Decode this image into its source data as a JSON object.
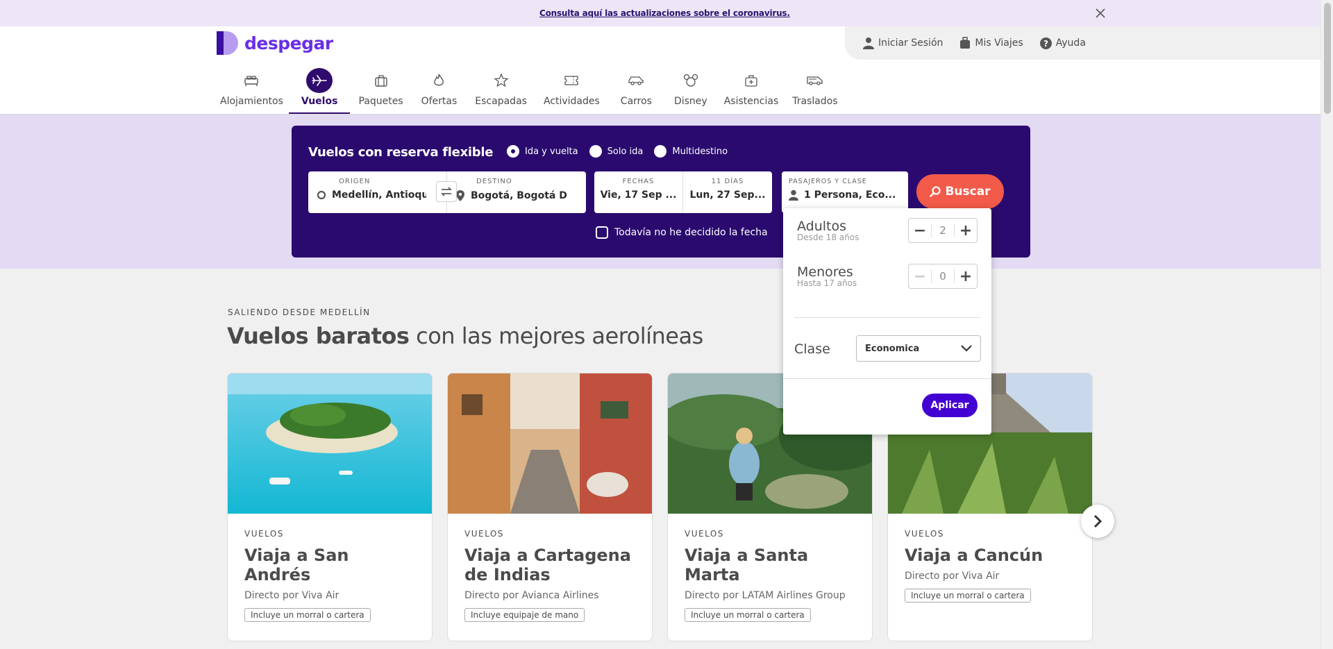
{
  "banner": {
    "link_text": "Consulta aquí las actualizaciones sobre el coronavirus."
  },
  "brand": {
    "name": "despegar"
  },
  "user_bar": [
    {
      "label": "Iniciar Sesión",
      "icon": "user-icon"
    },
    {
      "label": "Mis Viajes",
      "icon": "suitcase-icon"
    },
    {
      "label": "Ayuda",
      "icon": "help-icon"
    }
  ],
  "nav": {
    "items": [
      {
        "label": "Alojamientos",
        "icon": "bed-icon"
      },
      {
        "label": "Vuelos",
        "icon": "plane-icon",
        "active": true
      },
      {
        "label": "Paquetes",
        "icon": "package-icon"
      },
      {
        "label": "Ofertas",
        "icon": "flame-icon"
      },
      {
        "label": "Escapadas",
        "icon": "star-icon"
      },
      {
        "label": "Actividades",
        "icon": "ticket-icon"
      },
      {
        "label": "Carros",
        "icon": "car-icon"
      },
      {
        "label": "Disney",
        "icon": "mickey-icon"
      },
      {
        "label": "Asistencias",
        "icon": "medkit-icon"
      },
      {
        "label": "Traslados",
        "icon": "van-icon"
      }
    ]
  },
  "search": {
    "title": "Vuelos con reserva flexible",
    "trip_types": [
      {
        "label": "Ida y vuelta",
        "checked": true
      },
      {
        "label": "Solo ida",
        "checked": false
      },
      {
        "label": "Multidestino",
        "checked": false
      }
    ],
    "origin": {
      "label": "ORIGEN",
      "value": "Medellín, Antioqui..."
    },
    "destination": {
      "label": "DESTINO",
      "value": "Bogotá, Bogotá D...."
    },
    "dates": {
      "label": "FECHAS",
      "value": "Vie, 17 Sep ..."
    },
    "days": {
      "label": "11 DÍAS",
      "value": "Lun, 27 Sep..."
    },
    "passengers": {
      "label": "PASAJEROS Y CLASE",
      "value": "1 Persona, Eco..."
    },
    "button": "Buscar",
    "undecided_label": "Todavía no he decidido la fecha"
  },
  "passengers_popup": {
    "adults": {
      "label": "Adultos",
      "sub": "Desde 18 años",
      "value": "2"
    },
    "minors": {
      "label": "Menores",
      "sub": "Hasta 17 años",
      "value": "0"
    },
    "class_label": "Clase",
    "class_value": "Economica",
    "apply": "Aplicar"
  },
  "section": {
    "kicker": "SALIENDO DESDE MEDELLÍN",
    "title_bold": "Vuelos baratos",
    "title_rest": " con las mejores aerolíneas"
  },
  "cards": [
    {
      "kicker": "VUELOS",
      "title": "Viaja a San Andrés",
      "sub": "Directo por Viva Air",
      "badge": "Incluye un morral o cartera"
    },
    {
      "kicker": "VUELOS",
      "title": "Viaja a Cartagena de Indias",
      "sub": "Directo por Avianca Airlines",
      "badge": "Incluye equipaje de mano"
    },
    {
      "kicker": "VUELOS",
      "title": "Viaja a Santa Marta",
      "sub": "Directo por LATAM Airlines Group",
      "badge": "Incluye un morral o cartera"
    },
    {
      "kicker": "VUELOS",
      "title": "Viaja a Cancún",
      "sub": "Directo por Viva Air",
      "badge": "Incluye un morral o cartera"
    }
  ],
  "colors": {
    "brand_purple": "#6a2ee8",
    "search_bg": "#2a0a6e",
    "buscar": "#f25a4a",
    "aplicar": "#4300d2"
  }
}
